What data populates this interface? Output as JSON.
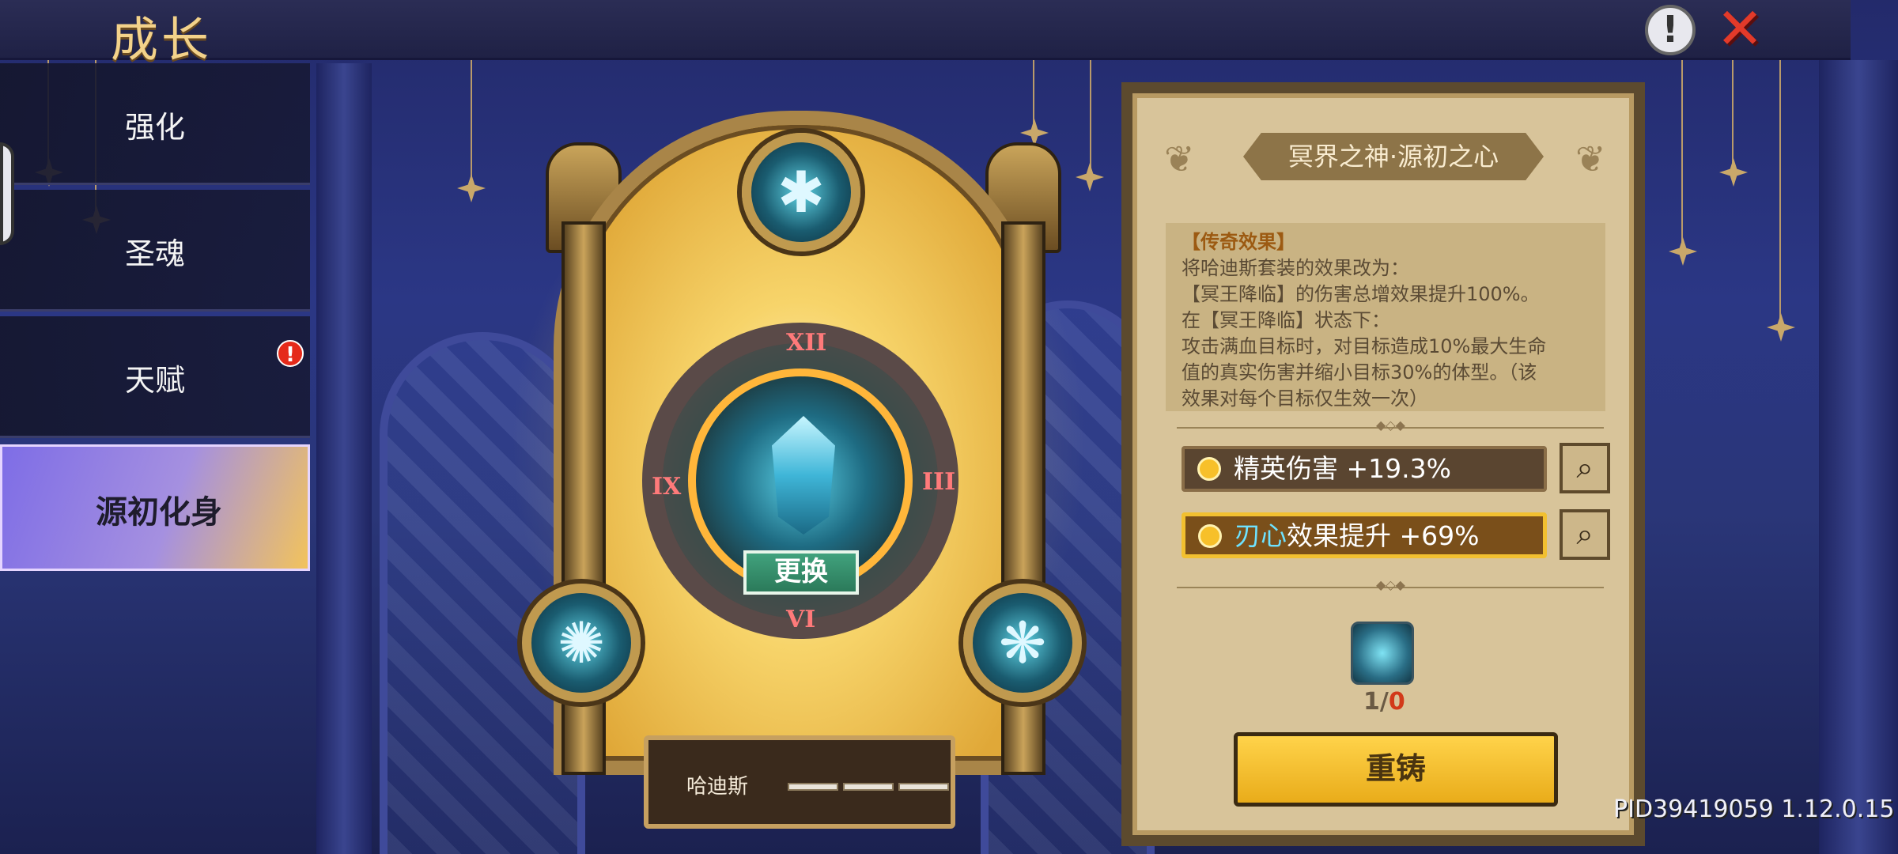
{
  "topbar": {
    "title": "成长"
  },
  "sidebar": {
    "items": [
      {
        "label": "强化",
        "active": false,
        "alert": false
      },
      {
        "label": "圣魂",
        "active": false,
        "alert": false
      },
      {
        "label": "天赋",
        "active": false,
        "alert": true,
        "alert_text": "!"
      },
      {
        "label": "源初化身",
        "active": true,
        "alert": false
      }
    ]
  },
  "shrine": {
    "swap_label": "更换",
    "numerals": {
      "top": "XII",
      "left": "IX",
      "right": "III",
      "bottom": "VI"
    },
    "hero_name": "哈迪斯",
    "hero_progress": 0
  },
  "panel": {
    "title": "冥界之神·源初之心",
    "legend": {
      "header": "【传奇效果】",
      "lines": [
        "将哈迪斯套装的效果改为：",
        "【冥王降临】的伤害总增效果提升100%。",
        "在【冥王降临】状态下：",
        "攻击满血目标时，对目标造成10%最大生命",
        "值的真实伤害并缩小目标30%的体型。（该",
        "效果对每个目标仅生效一次）"
      ]
    },
    "stats": [
      {
        "text": "精英伤害 +19.3%",
        "highlight": ""
      },
      {
        "text": "效果提升 +69%",
        "highlight": "刃心"
      }
    ],
    "item_count_current": "1/",
    "item_count_need": "0",
    "reforge_label": "重铸"
  },
  "footer": {
    "pid": "PID39419059 1.12.0.15"
  },
  "colors": {
    "accent_gold": "#f2c030",
    "title_gold": "#f3d28a",
    "alert_red": "#e52a1a",
    "swap_green": "#41a27d"
  },
  "icons": [
    "info-icon",
    "close-icon",
    "search-zoom-icon",
    "sun-icon"
  ]
}
